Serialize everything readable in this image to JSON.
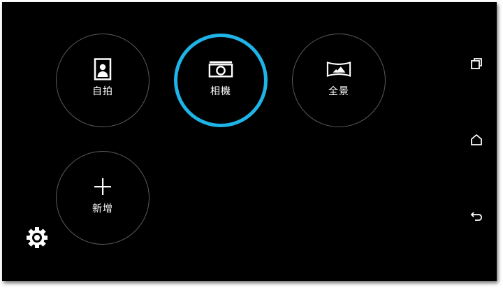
{
  "modes": [
    {
      "label": "自拍",
      "icon": "selfie-portrait-icon"
    },
    {
      "label": "相機",
      "icon": "camera-icon",
      "selected": true
    },
    {
      "label": "全景",
      "icon": "panorama-icon"
    },
    {
      "label": "新增",
      "icon": "plus-icon"
    }
  ],
  "nav": {
    "recent": "recent-apps-icon",
    "home": "home-icon",
    "back": "back-icon"
  },
  "settings": {
    "icon": "gear-icon"
  },
  "colors": {
    "background": "#000000",
    "accent": "#1fb4e8",
    "ring": "#5a5a5a",
    "text": "#ffffff"
  }
}
